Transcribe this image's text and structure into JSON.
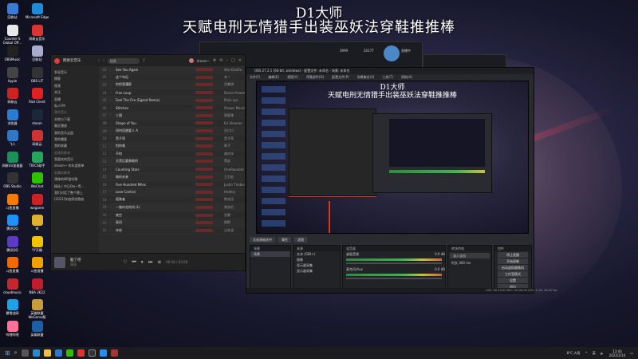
{
  "overlay": {
    "title_line1": "D1大师",
    "title_line2": "天赋电刑无情猎手出装巫妖法穿鞋推推棒"
  },
  "desktop_icons": [
    {
      "label": "回收站",
      "color": "#3a7bd5"
    },
    {
      "label": "Microsoft Edge",
      "color": "#1f8bd6"
    },
    {
      "label": "Counter-S Global Off...",
      "color": "#e8e8e8"
    },
    {
      "label": "网易云音乐",
      "color": "#d33"
    },
    {
      "label": "OBSMusic",
      "color": "#222"
    },
    {
      "label": "回收站",
      "color": "#aac"
    },
    {
      "label": "Apple",
      "color": "#444"
    },
    {
      "label": "OBS LIT",
      "color": "#333"
    },
    {
      "label": "网易云",
      "color": "#c22"
    },
    {
      "label": "Riot Client",
      "color": "#d22"
    },
    {
      "label": "浏览器",
      "color": "#2a7ad2"
    },
    {
      "label": "steam",
      "color": "#1b2838"
    },
    {
      "label": "飞人",
      "color": "#2d78c9"
    },
    {
      "label": "网易云",
      "color": "#c33"
    },
    {
      "label": "网易UU加速器",
      "color": "#1d8f5a"
    },
    {
      "label": "TIOCS助手",
      "color": "#26a65b"
    },
    {
      "label": "OBS Studio",
      "color": "#333"
    },
    {
      "label": "WeChat",
      "color": "#2dc100"
    },
    {
      "label": "斗鱼直播",
      "color": "#f57c00"
    },
    {
      "label": "wegame",
      "color": "#c22"
    },
    {
      "label": "腾讯QQ",
      "color": "#1e90ff"
    },
    {
      "label": "W",
      "color": "#ddb12c"
    },
    {
      "label": "腾讯QQ",
      "color": "#5b3ac7"
    },
    {
      "label": "YY开播",
      "color": "#f2c400"
    },
    {
      "label": "斗鱼直播",
      "color": "#f06a00"
    },
    {
      "label": "斗鱼直播",
      "color": "#f0a000"
    },
    {
      "label": "cloudmusic",
      "color": "#c2272d"
    },
    {
      "label": "NBA 2K22",
      "color": "#c21d2c"
    },
    {
      "label": "暴雪战网",
      "color": "#1fa1e8"
    },
    {
      "label": "英雄联盟 WeGame版",
      "color": "#c89b3c"
    },
    {
      "label": "哔哩哔哩",
      "color": "#fb7299"
    },
    {
      "label": "英雄联盟",
      "color": "#1b5fa5"
    }
  ],
  "music_app": {
    "logo_text": "网易云音乐",
    "search_placeholder": "搜索",
    "user": "dream~",
    "sidebar": [
      "发现音乐",
      "播客",
      "视频",
      "关注",
      "直播",
      "私人FM",
      "我的音乐",
      "本地与下载",
      "最近播放",
      "我的音乐云盘",
      "我的播客",
      "我的收藏",
      "创建的歌单",
      "我喜欢的音乐",
      "dream~ 的年度歌单",
      "收藏的歌单",
      "漂移的NP爱听歌",
      "精选 | 节日Ow~等…",
      "我们对话了整个晚上",
      "[2021]年度原创歌曲"
    ],
    "songs": [
      {
        "n": "01",
        "t": "See You Again",
        "a": "Wiz Khalifa"
      },
      {
        "n": "02",
        "t": "这个年纪",
        "a": "齐一"
      },
      {
        "n": "03",
        "t": "你把我灌醉",
        "a": "邓紫棋"
      },
      {
        "n": "04",
        "t": "Free Loop",
        "a": "Daniel Powter"
      },
      {
        "n": "05",
        "t": "Feel The Fire (Egzod Remix)",
        "a": "Plain Lyo"
      },
      {
        "n": "06",
        "t": "Stitches",
        "a": "Shawn Mendes"
      },
      {
        "n": "07",
        "t": "三国",
        "a": "周星驰"
      },
      {
        "n": "08",
        "t": "Shape of You",
        "a": "Ed Sheeran"
      },
      {
        "n": "09",
        "t": "如何回避爱人 A",
        "a": "吕口口"
      },
      {
        "n": "10",
        "t": "黑子哥",
        "a": "黑子哥"
      },
      {
        "n": "11",
        "t": "怕你难",
        "a": "胖子"
      },
      {
        "n": "12",
        "t": "不怕",
        "a": "曲肖冰"
      },
      {
        "n": "13",
        "t": "天黑后要勇敢的",
        "a": "黑皮"
      },
      {
        "n": "14",
        "t": "Counting Stars",
        "a": "OneRepublic"
      },
      {
        "n": "15",
        "t": "暗听未来",
        "a": "王力宏"
      },
      {
        "n": "16",
        "t": "Five Hundred Miles",
        "a": "Justin Timberlake"
      },
      {
        "n": "17",
        "t": "Lose Control",
        "a": "Hedley"
      },
      {
        "n": "18",
        "t": "孤勇者",
        "a": "陈奕迅"
      },
      {
        "n": "19",
        "t": "一路向北的风 (L)",
        "a": "周杰伦"
      },
      {
        "n": "20",
        "t": "夜空",
        "a": "花粥"
      },
      {
        "n": "21",
        "t": "乘风",
        "a": "斯斯"
      },
      {
        "n": "22",
        "t": "年轮",
        "a": "汪苏泷"
      }
    ],
    "now_playing": {
      "title": "脑了吧",
      "artist": "周深",
      "time": "00:10 / 03:58"
    }
  },
  "small_windows": {
    "stream_viewers": "3999",
    "stream_likes": "20177",
    "stream_label": "直播中"
  },
  "obs": {
    "title": "OBS 27.2.1 (64-bit, windows) - 配置文件: 未命名 - 场景: 未命名",
    "menu": [
      "文件(F)",
      "编辑(E)",
      "视图(V)",
      "停靠部件(D)",
      "配置文件(P)",
      "场景集合(S)",
      "工具(T)",
      "帮助(H)"
    ],
    "tabs": [
      "无来源被选中",
      "属性",
      "滤镜"
    ],
    "scenes_header": "场景",
    "scenes": [
      "场景"
    ],
    "sources_header": "来源",
    "sources": [
      "文本 (GDI+)",
      "图像",
      "显示器采集",
      "显示器采集"
    ],
    "mixer_header": "混音器",
    "mixer": [
      {
        "name": "桌面音频",
        "db": "0.0 dB"
      },
      {
        "name": "麦克风/Aux",
        "db": "0.0 dB"
      }
    ],
    "transition_header": "转场特效",
    "transition_value": "淡入淡出",
    "transition_duration_label": "时长",
    "transition_duration": "300 ms",
    "controls_header": "控件",
    "controls": [
      "停止直播",
      "开始录制",
      "启动虚拟摄像机",
      "工作室模式",
      "设置",
      "退出"
    ],
    "status": "LIVE: 00:19:59   REC: 00:00:00   CPU: 4.4%, 60.00 fps"
  },
  "taskbar": {
    "weather": "8°C 大雨",
    "time": "13:43",
    "date": "2022/2/14",
    "tray_lang": "英"
  }
}
